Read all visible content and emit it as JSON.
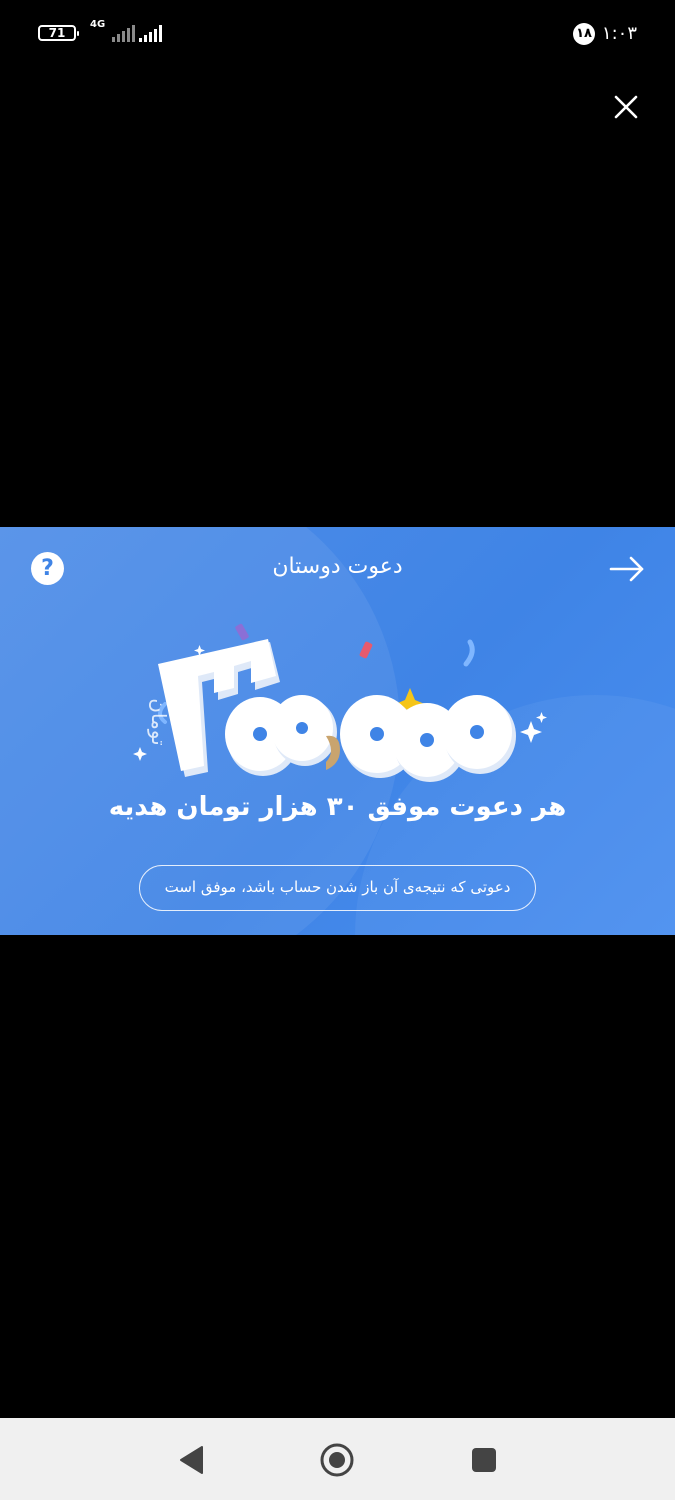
{
  "status_bar": {
    "battery_level": "71",
    "network_type": "4G",
    "notification_count": "۱۸",
    "time": "۱:۰۳"
  },
  "overlay": {
    "close_icon": "close-icon"
  },
  "banner": {
    "title": "دعوت دوستان",
    "help_label": "?",
    "back_icon": "arrow-right-icon",
    "art": {
      "amount": "۳۰۰٫۰۰۰",
      "currency": "تومان"
    },
    "headline": "هر دعوت موفق ۳۰ هزار تومان هدیه",
    "note": "دعوتی که نتیجه‌ی آن باز شدن حساب باشد، موفق است",
    "colors": {
      "background": "#3f84e6",
      "accent_yellow": "#f5c518"
    }
  },
  "nav_bar": {
    "back_icon": "triangle-back-icon",
    "home_icon": "circle-home-icon",
    "recents_icon": "square-recents-icon"
  }
}
